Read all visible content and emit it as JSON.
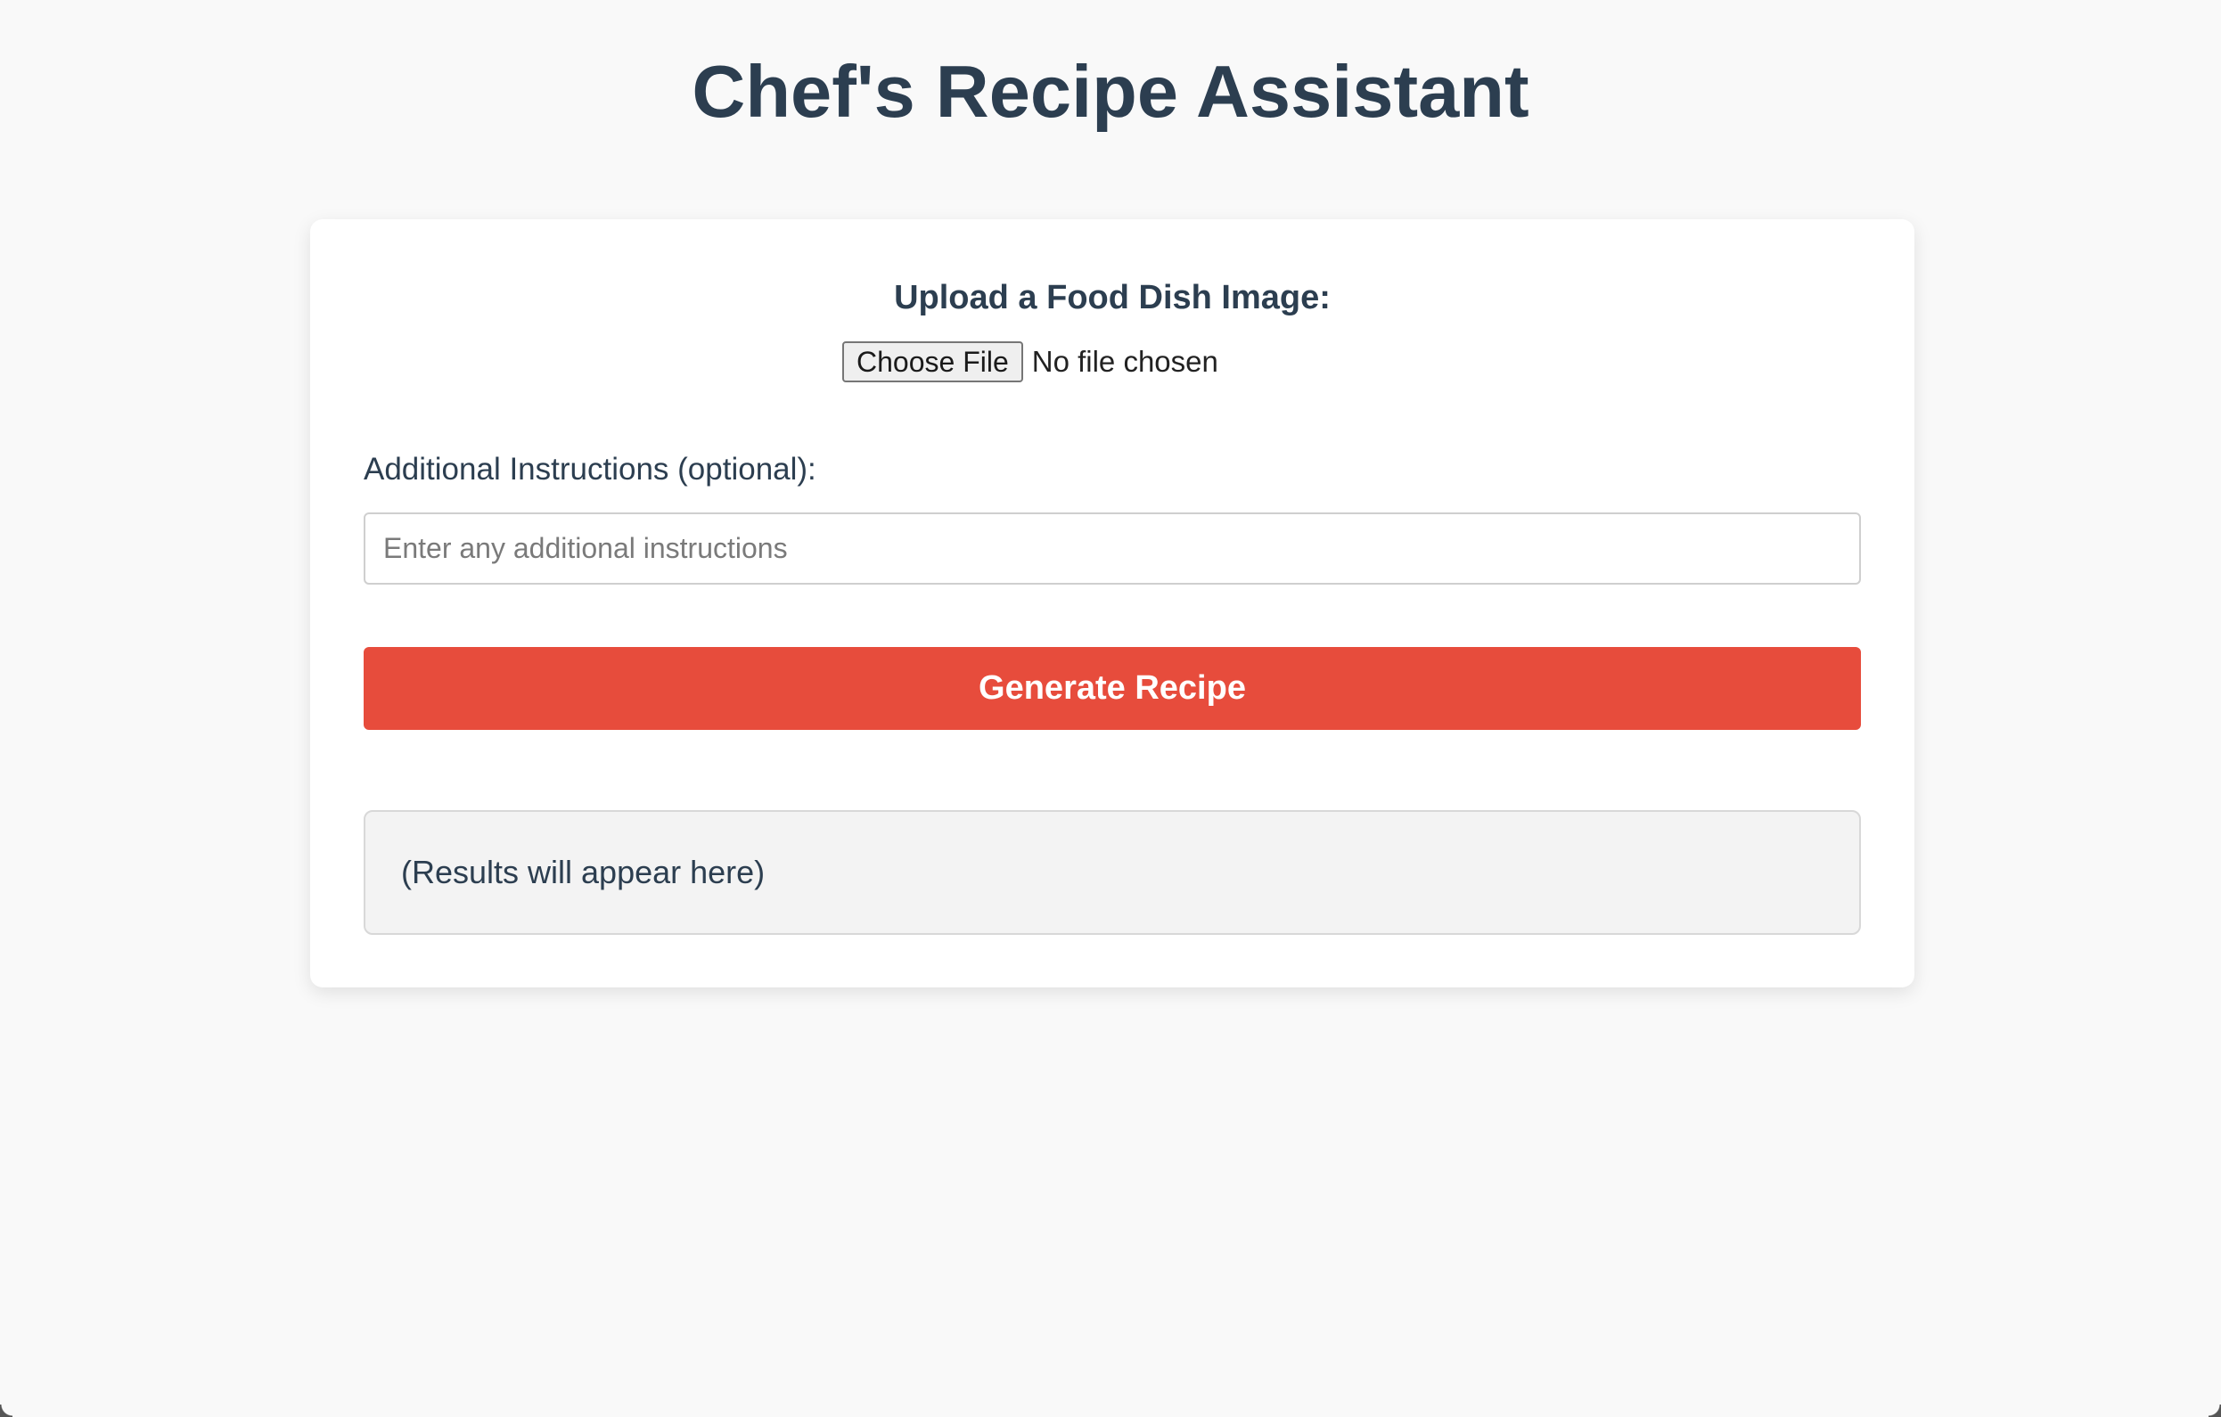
{
  "page": {
    "title": "Chef's Recipe Assistant"
  },
  "upload": {
    "label": "Upload a Food Dish Image:",
    "choose_file_label": "Choose File",
    "file_status": "No file chosen"
  },
  "instructions": {
    "label": "Additional Instructions (optional):",
    "placeholder": "Enter any additional instructions",
    "value": ""
  },
  "actions": {
    "generate_label": "Generate Recipe"
  },
  "results": {
    "text": "(Results will appear here)"
  },
  "colors": {
    "background": "#f9f9f9",
    "text": "#2c3e50",
    "accent": "#e74c3c",
    "card": "#ffffff",
    "results_bg": "#f3f3f3"
  }
}
